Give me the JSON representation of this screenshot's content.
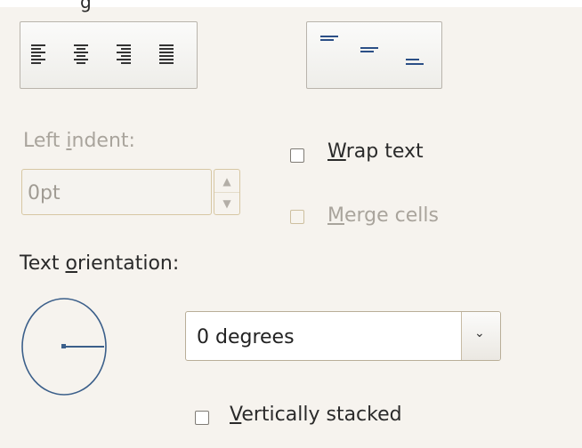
{
  "header": {
    "cut_off_text": "g"
  },
  "horizontal_alignment": {
    "options": [
      {
        "name": "left",
        "icon": "align-left-icon"
      },
      {
        "name": "center",
        "icon": "align-center-icon"
      },
      {
        "name": "right",
        "icon": "align-right-icon"
      },
      {
        "name": "justify",
        "icon": "align-justify-icon"
      }
    ]
  },
  "vertical_alignment": {
    "options": [
      {
        "name": "top",
        "icon": "valign-top-icon"
      },
      {
        "name": "middle",
        "icon": "valign-middle-icon"
      },
      {
        "name": "bottom",
        "icon": "valign-bottom-icon"
      }
    ]
  },
  "left_indent": {
    "label_pre": "Left ",
    "label_mnemonic": "i",
    "label_post": "ndent:",
    "value": "0pt",
    "enabled": false
  },
  "wrap_text": {
    "label_mnemonic": "W",
    "label_post": "rap text",
    "checked": false,
    "enabled": true
  },
  "merge_cells": {
    "label_mnemonic": "M",
    "label_post": "erge cells",
    "checked": false,
    "enabled": false
  },
  "text_orientation": {
    "label_pre": "Text ",
    "label_mnemonic": "o",
    "label_post": "rientation:",
    "selected": "0 degrees"
  },
  "vertically_stacked": {
    "label_mnemonic": "V",
    "label_post": "ertically stacked",
    "checked": false,
    "enabled": true
  },
  "colors": {
    "dial_stroke": "#3b5f8a",
    "disabled_text": "#a9a49c",
    "background": "#f6f3ee"
  }
}
